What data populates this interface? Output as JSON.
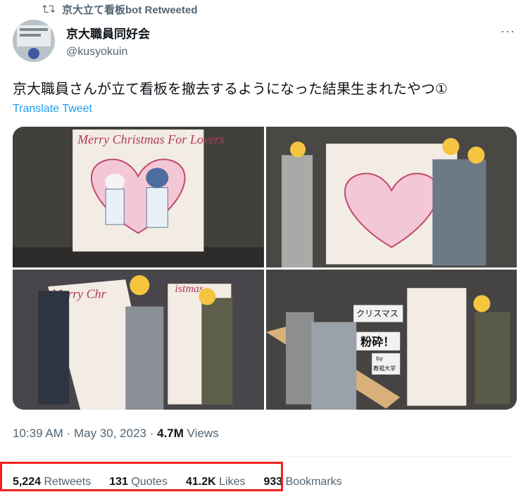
{
  "retweet": {
    "label": "京大立て看板bot Retweeted",
    "icon": "retweet-icon"
  },
  "author": {
    "display_name": "京大職員同好会",
    "handle": "@kusyokuin"
  },
  "more": "···",
  "tweet": {
    "text": "京大職員さんが立て看板を撤去するようになった結果生まれたやつ①",
    "translate_label": "Translate Tweet"
  },
  "media": {
    "sign_text": "Merry Christmas For Lovers",
    "sign_text_short": "istmas",
    "sign_text_christmas": "Merry Chr",
    "board_line1": "クリスマス",
    "board_line2": "粉砕！",
    "board_line3": "by",
    "board_line4": "教祖大学"
  },
  "meta": {
    "time": "10:39 AM",
    "sep1": "·",
    "date": "May 30, 2023",
    "sep2": "·",
    "views": "4.7M",
    "views_label": "Views"
  },
  "stats": [
    {
      "count": "5,224",
      "label": "Retweets"
    },
    {
      "count": "131",
      "label": "Quotes"
    },
    {
      "count": "41.2K",
      "label": "Likes"
    },
    {
      "count": "933",
      "label": "Bookmarks"
    }
  ],
  "colors": {
    "accent": "#1d9bf0",
    "secondary": "#536471",
    "highlight": "#f02020"
  }
}
